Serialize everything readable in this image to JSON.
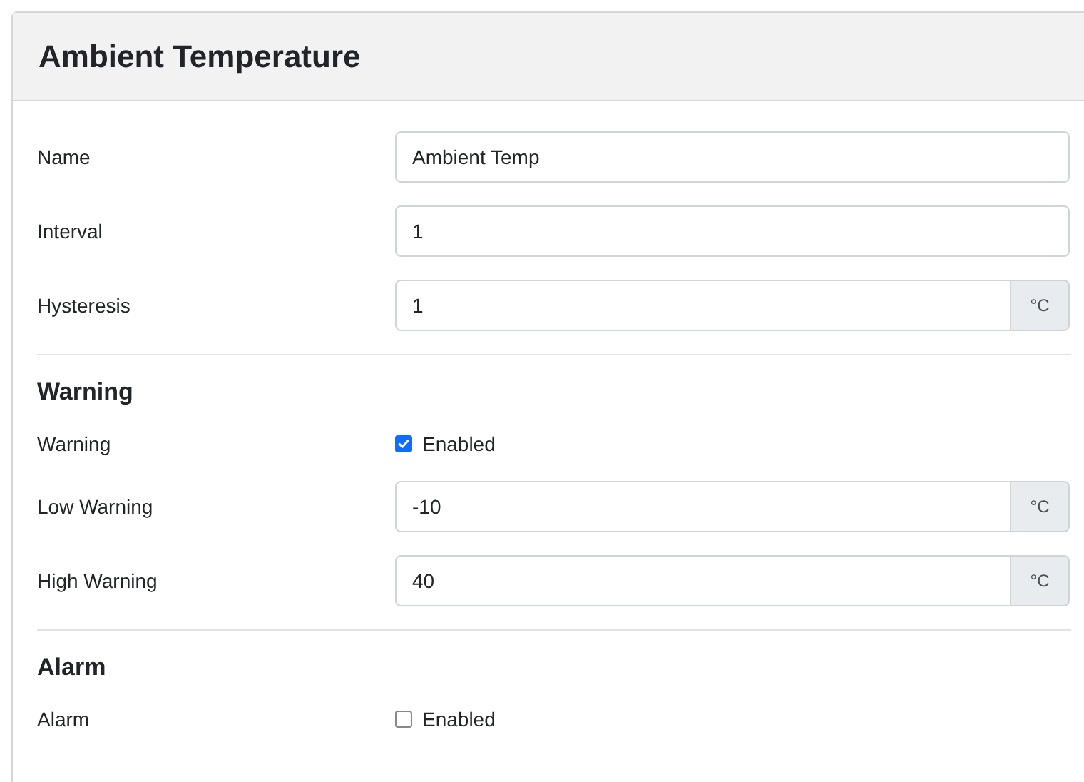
{
  "card": {
    "title": "Ambient Temperature"
  },
  "sections": [
    {
      "rows": [
        {
          "kind": "text",
          "label": "Name",
          "value": "Ambient Temp"
        },
        {
          "kind": "text",
          "label": "Interval",
          "value": "1"
        },
        {
          "kind": "addon",
          "label": "Hysteresis",
          "value": "1",
          "unit": "°C"
        }
      ]
    },
    {
      "heading": "Warning",
      "rows": [
        {
          "kind": "checkbox",
          "label": "Warning",
          "text": "Enabled",
          "checked": true
        },
        {
          "kind": "addon",
          "label": "Low Warning",
          "value": "-10",
          "unit": "°C"
        },
        {
          "kind": "addon",
          "label": "High Warning",
          "value": "40",
          "unit": "°C"
        }
      ]
    },
    {
      "heading": "Alarm",
      "rows": [
        {
          "kind": "checkbox",
          "label": "Alarm",
          "text": "Enabled",
          "checked": false
        }
      ]
    }
  ]
}
